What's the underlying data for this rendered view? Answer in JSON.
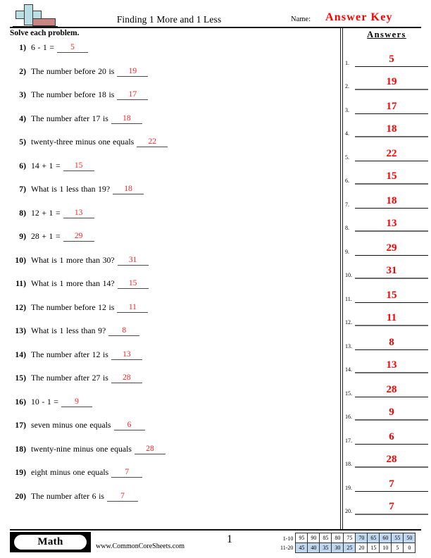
{
  "header": {
    "logo_icon": "plus-minus-logo",
    "title": "Finding 1 More and 1 Less",
    "name_label": "Name:",
    "answer_key_label": "Answer Key",
    "instructions": "Solve each problem."
  },
  "problems": [
    {
      "num": "1)",
      "text": "6 - 1 =",
      "answer": "5"
    },
    {
      "num": "2)",
      "text": "The number before 20 is",
      "answer": "19"
    },
    {
      "num": "3)",
      "text": "The number before 18 is",
      "answer": "17"
    },
    {
      "num": "4)",
      "text": "The number after 17 is",
      "answer": "18"
    },
    {
      "num": "5)",
      "text": "twenty-three minus one equals",
      "answer": "22"
    },
    {
      "num": "6)",
      "text": "14 + 1 =",
      "answer": "15"
    },
    {
      "num": "7)",
      "text": "What is 1 less than 19?",
      "answer": "18"
    },
    {
      "num": "8)",
      "text": "12 + 1 =",
      "answer": "13"
    },
    {
      "num": "9)",
      "text": "28 + 1 =",
      "answer": "29"
    },
    {
      "num": "10)",
      "text": "What is 1 more than 30?",
      "answer": "31"
    },
    {
      "num": "11)",
      "text": "What is 1 more than 14?",
      "answer": "15"
    },
    {
      "num": "12)",
      "text": "The number before 12 is",
      "answer": "11"
    },
    {
      "num": "13)",
      "text": "What is 1 less than 9?",
      "answer": "8"
    },
    {
      "num": "14)",
      "text": "The number after 12 is",
      "answer": "13"
    },
    {
      "num": "15)",
      "text": "The number after 27 is",
      "answer": "28"
    },
    {
      "num": "16)",
      "text": "10 - 1 =",
      "answer": "9"
    },
    {
      "num": "17)",
      "text": "seven minus one equals",
      "answer": "6"
    },
    {
      "num": "18)",
      "text": "twenty-nine minus one equals",
      "answer": "28"
    },
    {
      "num": "19)",
      "text": "eight minus one equals",
      "answer": "7"
    },
    {
      "num": "20)",
      "text": "The number after 6 is",
      "answer": "7"
    }
  ],
  "answers_panel": {
    "title": "Answers",
    "rows": [
      {
        "num": "1.",
        "value": "5"
      },
      {
        "num": "2.",
        "value": "19"
      },
      {
        "num": "3.",
        "value": "17"
      },
      {
        "num": "4.",
        "value": "18"
      },
      {
        "num": "5.",
        "value": "22"
      },
      {
        "num": "6.",
        "value": "15"
      },
      {
        "num": "7.",
        "value": "18"
      },
      {
        "num": "8.",
        "value": "13"
      },
      {
        "num": "9.",
        "value": "29"
      },
      {
        "num": "10.",
        "value": "31"
      },
      {
        "num": "11.",
        "value": "15"
      },
      {
        "num": "12.",
        "value": "11"
      },
      {
        "num": "13.",
        "value": "8"
      },
      {
        "num": "14.",
        "value": "13"
      },
      {
        "num": "15.",
        "value": "28"
      },
      {
        "num": "16.",
        "value": "9"
      },
      {
        "num": "17.",
        "value": "6"
      },
      {
        "num": "18.",
        "value": "28"
      },
      {
        "num": "19.",
        "value": "7"
      },
      {
        "num": "20.",
        "value": "7"
      }
    ]
  },
  "footer": {
    "subject_badge": "Math",
    "site_url": "www.CommonCoreSheets.com",
    "page_number": "1",
    "score_table": {
      "row_labels": [
        "1-10",
        "11-20"
      ],
      "rows": [
        {
          "label": "1-10",
          "cells": [
            {
              "v": "95",
              "hl": false
            },
            {
              "v": "90",
              "hl": false
            },
            {
              "v": "85",
              "hl": false
            },
            {
              "v": "80",
              "hl": false
            },
            {
              "v": "75",
              "hl": false
            },
            {
              "v": "70",
              "hl": true
            },
            {
              "v": "65",
              "hl": true
            },
            {
              "v": "60",
              "hl": true
            },
            {
              "v": "55",
              "hl": true
            },
            {
              "v": "50",
              "hl": true
            }
          ]
        },
        {
          "label": "11-20",
          "cells": [
            {
              "v": "45",
              "hl": true
            },
            {
              "v": "40",
              "hl": true
            },
            {
              "v": "35",
              "hl": true
            },
            {
              "v": "30",
              "hl": true
            },
            {
              "v": "25",
              "hl": true
            },
            {
              "v": "20",
              "hl": false
            },
            {
              "v": "15",
              "hl": false
            },
            {
              "v": "10",
              "hl": false
            },
            {
              "v": "5",
              "hl": false
            },
            {
              "v": "0",
              "hl": false
            }
          ]
        }
      ]
    }
  },
  "colors": {
    "answer_red": "#ff0000",
    "highlight_blue": "#bfd7ef",
    "logo_plus": "#b9dee3",
    "logo_minus": "#c98582"
  }
}
